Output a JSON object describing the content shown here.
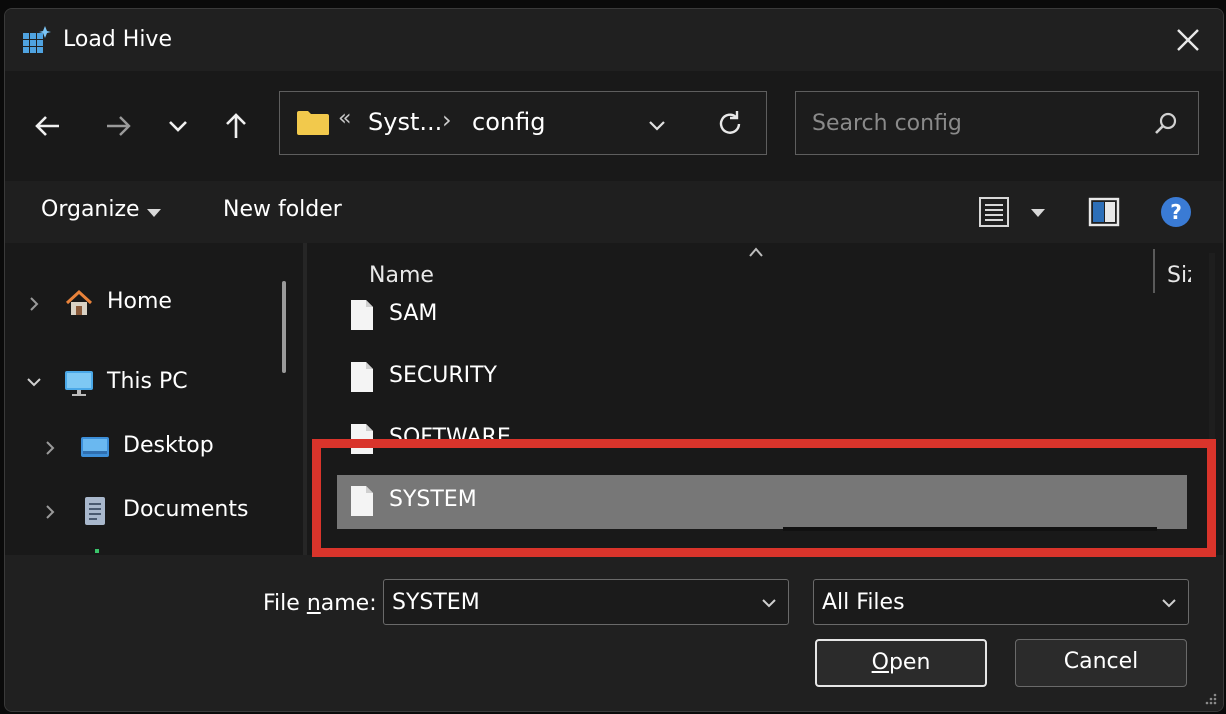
{
  "window": {
    "title": "Load Hive"
  },
  "nav": {
    "breadcrumb_overflow": "«",
    "breadcrumbs": [
      "Syst...",
      "config"
    ],
    "breadcrumb_separator": "›",
    "search_placeholder": "Search config"
  },
  "toolbar": {
    "organize_label": "Organize",
    "new_folder_label": "New folder"
  },
  "sidebar": {
    "items": [
      {
        "label": "Home",
        "icon": "home-icon",
        "expanded": false
      },
      {
        "label": "This PC",
        "icon": "computer-icon",
        "expanded": true
      },
      {
        "label": "Desktop",
        "icon": "desktop-folder-icon",
        "expanded": false
      },
      {
        "label": "Documents",
        "icon": "documents-icon",
        "expanded": false
      }
    ]
  },
  "filelist": {
    "columns": {
      "name": "Name",
      "size": "Size"
    },
    "files": [
      {
        "name": "SAM",
        "selected": false
      },
      {
        "name": "SECURITY",
        "selected": false
      },
      {
        "name": "SOFTWARE",
        "selected": false
      },
      {
        "name": "SYSTEM",
        "selected": true
      }
    ]
  },
  "footer": {
    "file_name_label_pre": "File ",
    "file_name_label_ul": "n",
    "file_name_label_post": "ame:",
    "file_name_value": "SYSTEM",
    "file_type_value": "All Files",
    "open_label_ul": "O",
    "open_label_rest": "pen",
    "cancel_label": "Cancel"
  },
  "colors": {
    "highlight": "#d9342b",
    "selected_row": "#777777",
    "folder": "#f2c94c",
    "help": "#3a7bd5"
  }
}
